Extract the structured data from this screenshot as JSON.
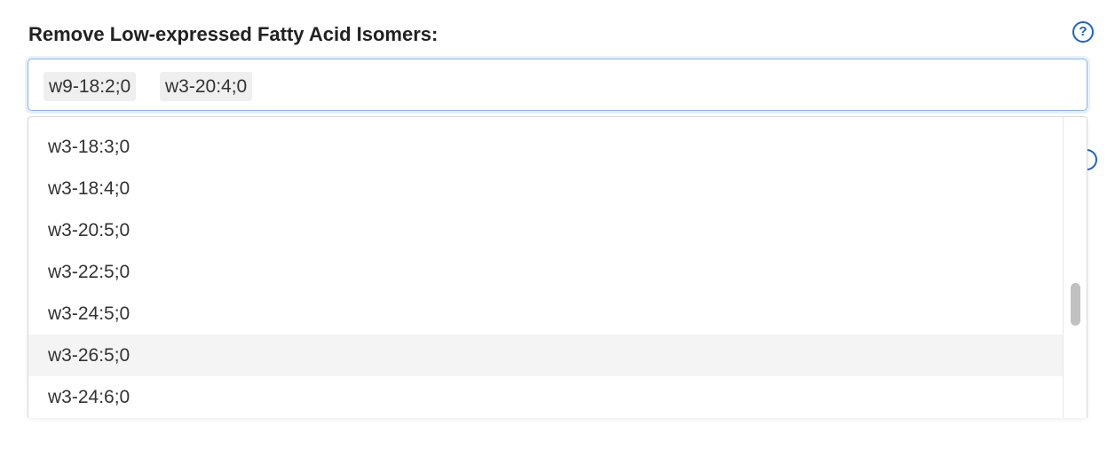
{
  "field": {
    "label": "Remove Low-expressed Fatty Acid Isomers:",
    "help_icon_glyph": "?",
    "accent_color": "#1d64c4"
  },
  "selected_tags": [
    "w9-18:2;0",
    "w3-20:4;0"
  ],
  "options": [
    "w3-18:3;0",
    "w3-18:4;0",
    "w3-20:5;0",
    "w3-22:5;0",
    "w3-24:5;0",
    "w3-26:5;0",
    "w3-24:6;0"
  ],
  "highlighted_option": "w3-26:5;0"
}
